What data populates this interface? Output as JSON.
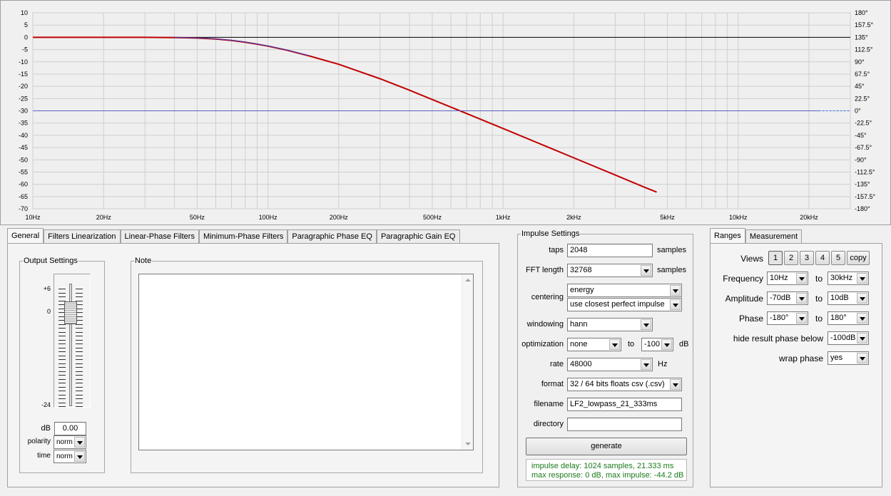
{
  "chart_data": {
    "type": "line",
    "x_scale": "log",
    "xlim": [
      10,
      30000
    ],
    "ylim": [
      -70,
      10
    ],
    "y2lim": [
      -180,
      180
    ],
    "grid": true,
    "x_ticks": [
      "10Hz",
      "20Hz",
      "50Hz",
      "100Hz",
      "200Hz",
      "500Hz",
      "1kHz",
      "2kHz",
      "5kHz",
      "10kHz",
      "20kHz"
    ],
    "y_ticks": [
      "10",
      "5",
      "0",
      "-5",
      "-10",
      "-15",
      "-20",
      "-25",
      "-30",
      "-35",
      "-40",
      "-45",
      "-50",
      "-55",
      "-60",
      "-65",
      "-70"
    ],
    "y2_ticks": [
      "180°",
      "157.5°",
      "135°",
      "112.5°",
      "90°",
      "67.5°",
      "45°",
      "22.5°",
      "0°",
      "-22.5°",
      "-45°",
      "-67.5°",
      "-90°",
      "-112.5°",
      "-135°",
      "-157.5°",
      "-180°"
    ],
    "series": [
      {
        "color": "#c00000",
        "x": [
          10,
          20,
          30,
          40,
          50,
          60,
          70,
          80,
          90,
          100,
          120,
          150,
          200,
          300,
          400,
          500,
          700,
          1000,
          2000,
          3000,
          4000,
          4500
        ],
        "y": [
          0,
          0,
          0,
          -0.1,
          -0.3,
          -0.7,
          -1.3,
          -2.0,
          -2.8,
          -3.6,
          -5.2,
          -7.6,
          -11.0,
          -16.9,
          -21.6,
          -25.4,
          -31.1,
          -37.2,
          -49.2,
          -56.2,
          -61.2,
          -63.2
        ]
      },
      {
        "color": "#4040c0",
        "x": [
          40,
          50,
          60,
          70,
          80,
          90,
          100,
          120,
          150
        ],
        "y": [
          -0.05,
          -0.25,
          -0.6,
          -1.2,
          -1.9,
          -2.7,
          -3.5,
          -5.1,
          -7.5
        ]
      },
      {
        "color": "#6060c0",
        "x": [
          10,
          22000
        ],
        "y": [
          -30,
          -30
        ]
      }
    ],
    "dashed_segment": {
      "color": "#3070e0",
      "x": [
        22000,
        30000
      ],
      "y": [
        -30,
        -30
      ]
    }
  },
  "tabs": [
    "General",
    "Filters Linearization",
    "Linear-Phase Filters",
    "Minimum-Phase Filters",
    "Paragraphic Phase EQ",
    "Paragraphic Gain EQ"
  ],
  "output_settings": {
    "legend": "Output Settings",
    "slider_top": "+6",
    "slider_zero": "0",
    "slider_bottom": "-24",
    "db_label": "dB",
    "db_value": "0.00",
    "polarity_label": "polarity",
    "polarity_value": "norm",
    "time_label": "time",
    "time_value": "norm"
  },
  "note": {
    "legend": "Note",
    "text": ""
  },
  "impulse": {
    "legend": "Impulse Settings",
    "taps_label": "taps",
    "taps_value": "2048",
    "taps_unit": "samples",
    "fft_label": "FFT length",
    "fft_value": "32768",
    "fft_unit": "samples",
    "centering_label": "centering",
    "centering_value1": "energy",
    "centering_value2": "use closest perfect impulse",
    "windowing_label": "windowing",
    "windowing_value": "hann",
    "optimization_label": "optimization",
    "optimization_value": "none",
    "optimization_to": "to",
    "optimization_db": "-100",
    "optimization_unit": "dB",
    "rate_label": "rate",
    "rate_value": "48000",
    "rate_unit": "Hz",
    "format_label": "format",
    "format_value": "32 / 64 bits floats csv (.csv)",
    "filename_label": "filename",
    "filename_value": "LF2_lowpass_21_333ms",
    "directory_label": "directory",
    "directory_value": "",
    "generate_label": "generate",
    "status_line1": "impulse delay: 1024 samples, 21.333 ms",
    "status_line2": "max response: 0 dB, max impulse: -44.2 dB"
  },
  "ranges": {
    "tabs": [
      "Ranges",
      "Measurement"
    ],
    "views_label": "Views",
    "views": [
      "1",
      "2",
      "3",
      "4",
      "5"
    ],
    "copy_label": "copy",
    "frequency_label": "Frequency",
    "frequency_from": "10Hz",
    "frequency_to": "30kHz",
    "amplitude_label": "Amplitude",
    "amplitude_from": "-70dB",
    "amplitude_to": "10dB",
    "phase_label": "Phase",
    "phase_from": "-180°",
    "phase_to": "180°",
    "to_label": "to",
    "hide_label": "hide result phase below",
    "hide_value": "-100dB",
    "wrap_label": "wrap phase",
    "wrap_value": "yes"
  },
  "colors": {
    "status_text": "#1a7a1a",
    "magnitude": "#c00000",
    "phase": "#4040c0"
  }
}
